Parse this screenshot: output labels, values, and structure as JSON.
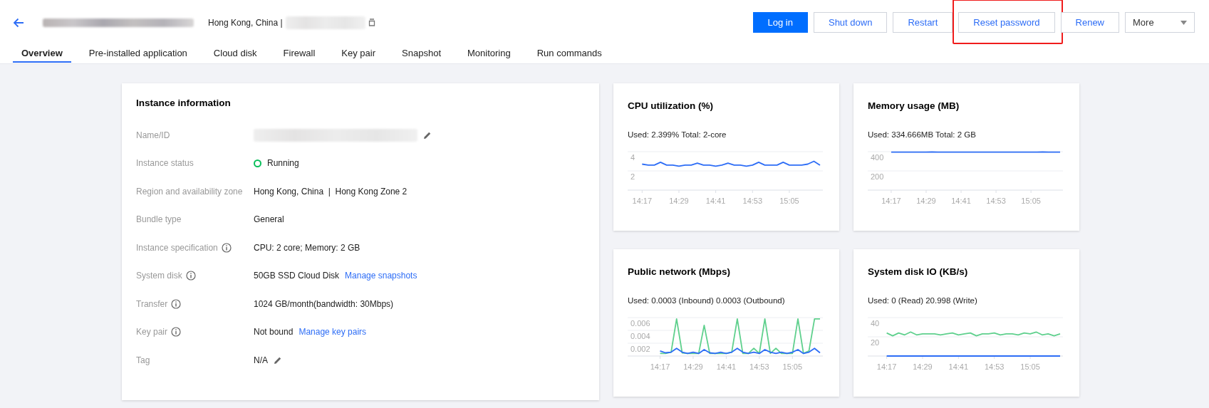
{
  "header": {
    "location": "Hong Kong, China |",
    "buttons": [
      {
        "label": "Log in",
        "kind": "primary",
        "highlighted": false
      },
      {
        "label": "Shut down",
        "kind": "default",
        "highlighted": false
      },
      {
        "label": "Restart",
        "kind": "default",
        "highlighted": false
      },
      {
        "label": "Reset password",
        "kind": "default",
        "highlighted": true
      },
      {
        "label": "Renew",
        "kind": "default",
        "highlighted": false
      },
      {
        "label": "More",
        "kind": "dropdown",
        "highlighted": false
      }
    ]
  },
  "tabs": [
    {
      "label": "Overview",
      "selected": true
    },
    {
      "label": "Pre-installed application",
      "selected": false
    },
    {
      "label": "Cloud disk",
      "selected": false
    },
    {
      "label": "Firewall",
      "selected": false
    },
    {
      "label": "Key pair",
      "selected": false
    },
    {
      "label": "Snapshot",
      "selected": false
    },
    {
      "label": "Monitoring",
      "selected": false
    },
    {
      "label": "Run commands",
      "selected": false
    }
  ],
  "instance_info": {
    "title": "Instance information",
    "rows": [
      {
        "label": "Name/ID",
        "kind": "redacted",
        "info": false,
        "editable": true
      },
      {
        "label": "Instance status",
        "kind": "status",
        "value": "Running",
        "info": false,
        "editable": false
      },
      {
        "label": "Region and availability zone",
        "kind": "text",
        "value": "Hong Kong, China  |  Hong Kong Zone 2",
        "info": false,
        "editable": false
      },
      {
        "label": "Bundle type",
        "kind": "text",
        "value": "General",
        "info": false,
        "editable": false
      },
      {
        "label": "Instance specification",
        "kind": "text",
        "value": "CPU: 2 core; Memory: 2 GB",
        "info": true,
        "editable": false
      },
      {
        "label": "System disk",
        "kind": "text",
        "value": "50GB SSD Cloud Disk",
        "link": "Manage snapshots",
        "info": true,
        "editable": false
      },
      {
        "label": "Transfer",
        "kind": "text",
        "value": "1024 GB/month(bandwidth: 30Mbps)",
        "info": true,
        "editable": false
      },
      {
        "label": "Key pair",
        "kind": "text",
        "value": "Not bound",
        "link": "Manage key pairs",
        "info": true,
        "editable": false
      },
      {
        "label": "Tag",
        "kind": "text",
        "value": "N/A",
        "info": false,
        "editable": true
      }
    ]
  },
  "metrics": [
    {
      "title": "CPU utilization (%)",
      "usage": "Used: 2.399% Total: 2-core",
      "chart_data": {
        "type": "line",
        "categories": [
          "14:17",
          null,
          null,
          null,
          null,
          null,
          "14:29",
          null,
          null,
          null,
          null,
          null,
          "14:41",
          null,
          null,
          null,
          null,
          null,
          "14:53",
          null,
          null,
          null,
          null,
          null,
          "15:05",
          null,
          null,
          null,
          null,
          null
        ],
        "ylim": [
          0,
          4
        ],
        "yticks": [
          2,
          4
        ],
        "series": [
          {
            "color": "#2d6df6",
            "values": [
              2.7,
              2.6,
              2.6,
              2.9,
              2.6,
              2.6,
              2.5,
              2.6,
              2.6,
              2.8,
              2.6,
              2.6,
              2.5,
              2.6,
              2.8,
              2.6,
              2.6,
              2.5,
              2.6,
              2.9,
              2.6,
              2.6,
              2.6,
              2.9,
              2.6,
              2.6,
              2.6,
              2.7,
              3.0,
              2.6
            ]
          }
        ]
      }
    },
    {
      "title": "Memory usage (MB)",
      "usage": "Used: 334.666MB Total: 2 GB",
      "chart_data": {
        "type": "line",
        "categories": [
          "14:17",
          null,
          null,
          null,
          null,
          null,
          "14:29",
          null,
          null,
          null,
          null,
          null,
          "14:41",
          null,
          null,
          null,
          null,
          null,
          "14:53",
          null,
          null,
          null,
          null,
          null,
          "15:05",
          null,
          null,
          null,
          null,
          null
        ],
        "ylim": [
          0,
          400
        ],
        "yticks": [
          200,
          400
        ],
        "series": [
          {
            "color": "#2d6df6",
            "values": [
              395,
              395,
              395,
              395,
              395,
              395,
              395,
              396,
              395,
              395,
              395,
              395,
              395,
              395,
              395,
              395,
              395,
              395,
              395,
              395,
              395,
              395,
              395,
              395,
              395,
              395,
              396,
              395,
              395,
              395
            ]
          }
        ]
      }
    },
    {
      "title": "Public network (Mbps)",
      "usage": "Used: 0.0003 (Inbound) 0.0003 (Outbound)",
      "chart_data": {
        "type": "line",
        "categories": [
          "14:17",
          null,
          null,
          null,
          null,
          null,
          "14:29",
          null,
          null,
          null,
          null,
          null,
          "14:41",
          null,
          null,
          null,
          null,
          null,
          "14:53",
          null,
          null,
          null,
          null,
          null,
          "15:05",
          null,
          null,
          null,
          null,
          null
        ],
        "ylim": [
          0,
          0.006
        ],
        "yticks": [
          0.002,
          0.004,
          0.006
        ],
        "series": [
          {
            "color": "#5fd08d",
            "values": [
              0.0004,
              0.0004,
              0.0006,
              0.0058,
              0.0005,
              0.0004,
              0.0004,
              0.0004,
              0.0048,
              0.0004,
              0.0004,
              0.0004,
              0.0004,
              0.0006,
              0.0058,
              0.0004,
              0.0004,
              0.0012,
              0.0004,
              0.0058,
              0.0004,
              0.0012,
              0.0004,
              0.0004,
              0.0004,
              0.0058,
              0.0004,
              0.0008,
              0.0058,
              0.0058
            ]
          },
          {
            "color": "#2d6df6",
            "values": [
              0.0008,
              0.0005,
              0.0006,
              0.0012,
              0.0006,
              0.0004,
              0.0006,
              0.0004,
              0.001,
              0.0005,
              0.0004,
              0.0006,
              0.0004,
              0.0006,
              0.0012,
              0.0006,
              0.0004,
              0.0006,
              0.0004,
              0.001,
              0.0006,
              0.0004,
              0.0006,
              0.0004,
              0.0006,
              0.001,
              0.0004,
              0.0006,
              0.0012,
              0.0005
            ]
          }
        ]
      }
    },
    {
      "title": "System disk IO (KB/s)",
      "usage": "Used: 0 (Read) 20.998 (Write)",
      "chart_data": {
        "type": "line",
        "categories": [
          "14:17",
          null,
          null,
          null,
          null,
          null,
          "14:29",
          null,
          null,
          null,
          null,
          null,
          "14:41",
          null,
          null,
          null,
          null,
          null,
          "14:53",
          null,
          null,
          null,
          null,
          null,
          "15:05",
          null,
          null,
          null,
          null,
          null
        ],
        "ylim": [
          0,
          40
        ],
        "yticks": [
          20,
          40
        ],
        "series": [
          {
            "color": "#5fd08d",
            "values": [
              24,
              21,
              24,
              22,
              25,
              22,
              23,
              23,
              23,
              22,
              23,
              24,
              22,
              23,
              24,
              21,
              23,
              23,
              24,
              22,
              23,
              23,
              22,
              24,
              23,
              25,
              22,
              23,
              21,
              23
            ]
          },
          {
            "color": "#2d6df6",
            "values": [
              0,
              0,
              0,
              0,
              0,
              0,
              0,
              0,
              0,
              0,
              0,
              0,
              0,
              0,
              0,
              0,
              0,
              0,
              0,
              0,
              0,
              0,
              0,
              0,
              0,
              0,
              0,
              0,
              0,
              0
            ]
          }
        ]
      }
    }
  ]
}
